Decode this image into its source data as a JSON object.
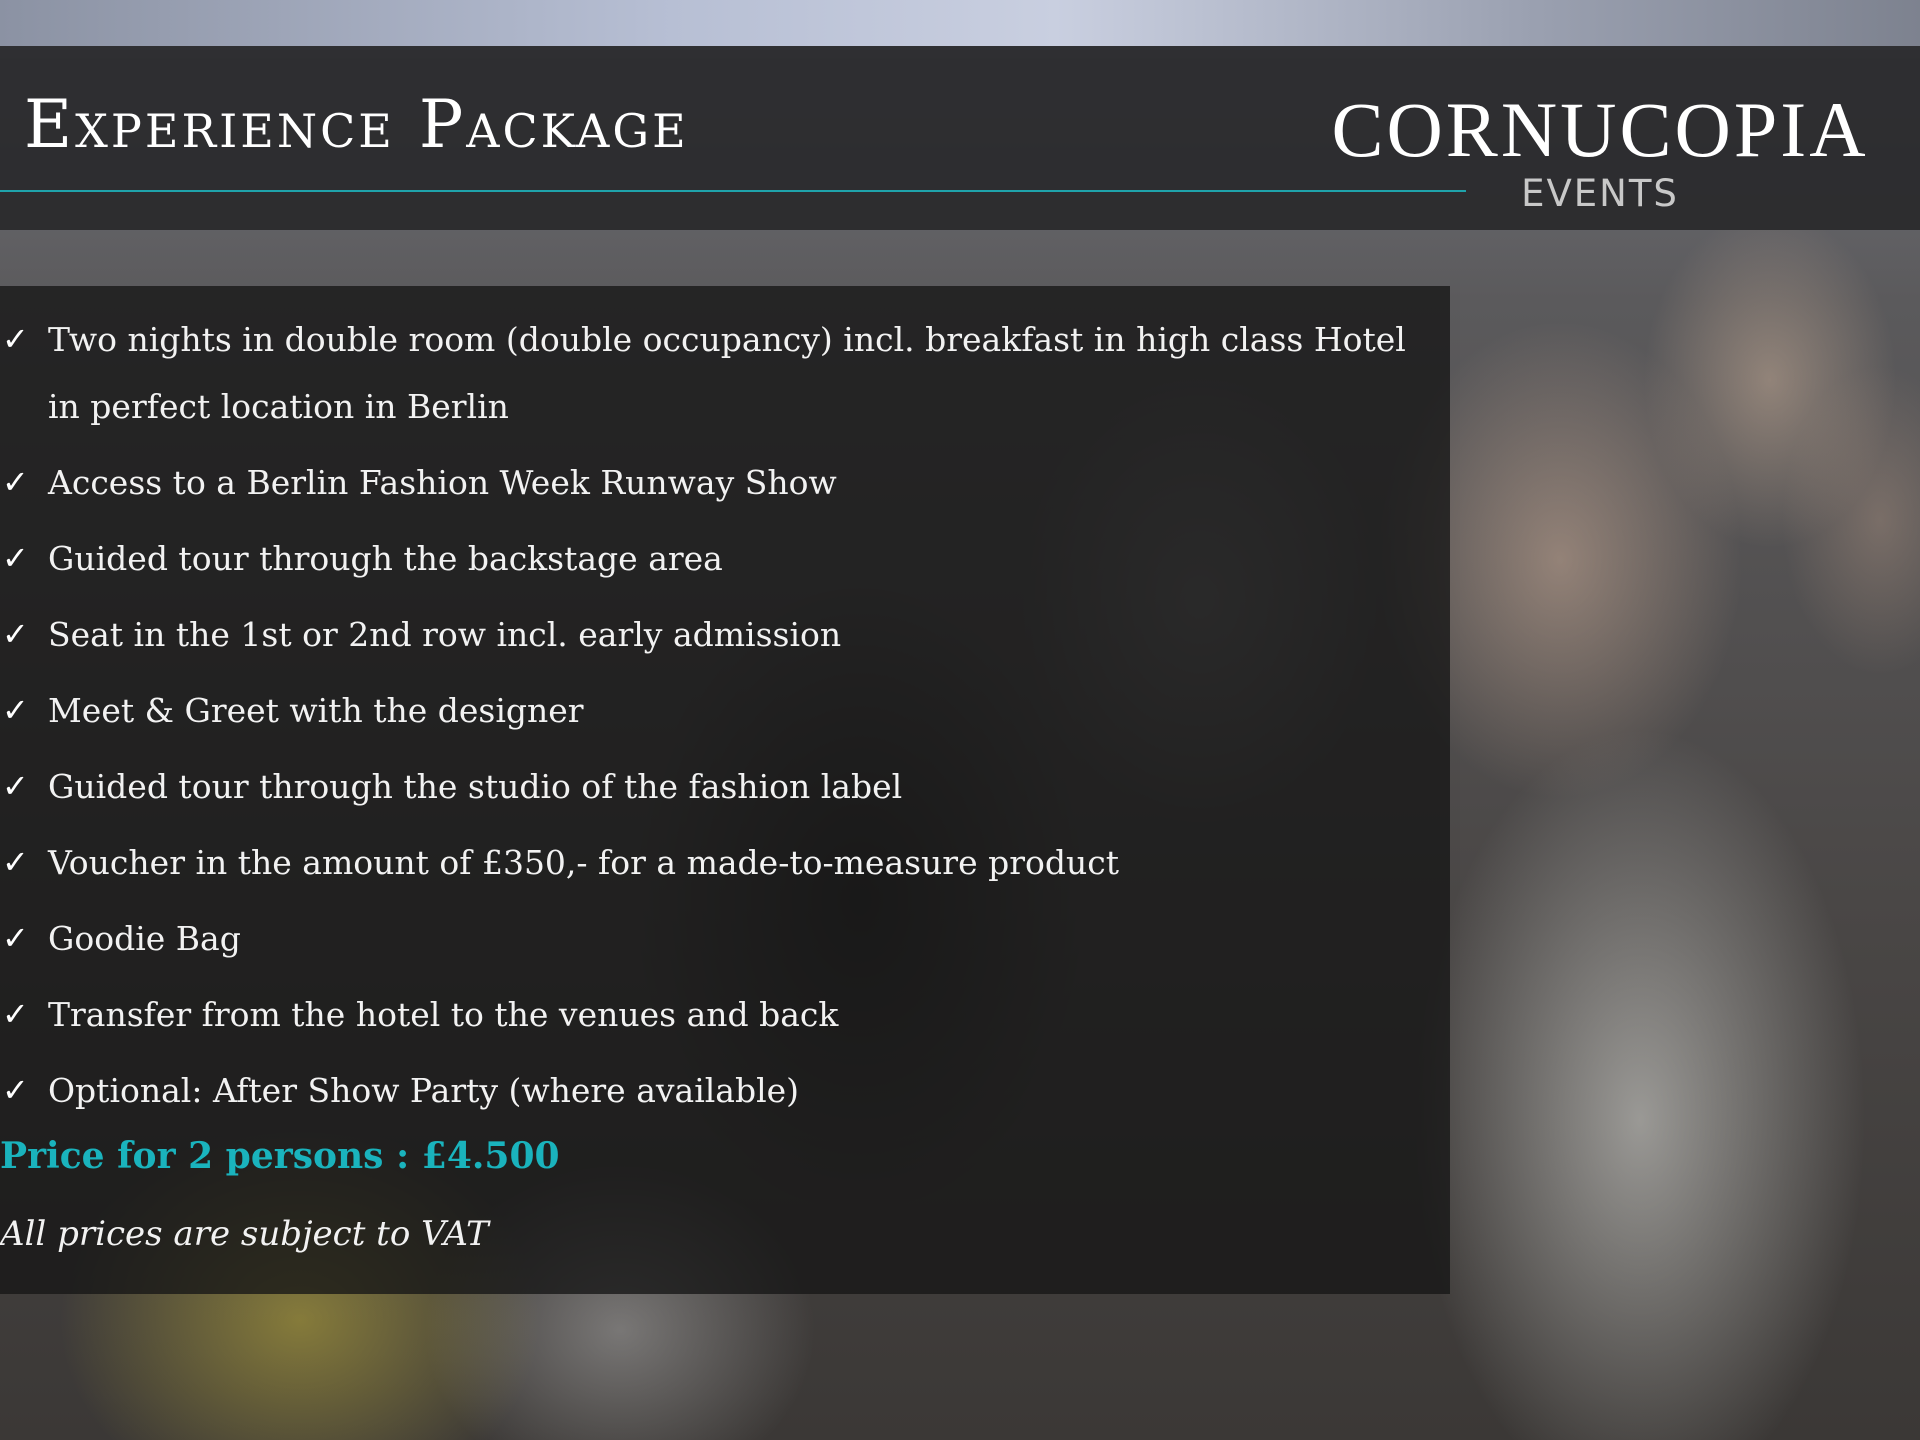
{
  "header": {
    "title": "Experience Package"
  },
  "logo": {
    "name": "CORNUCOPIA",
    "sub": "EVENTS"
  },
  "features": {
    "icon": "check-icon",
    "glyph": "✓",
    "items": [
      "Two nights in double room (double occupancy) incl. breakfast in high class Hotel in perfect location in Berlin",
      "Access to a Berlin Fashion Week Runway Show",
      "Guided tour through the backstage area",
      "Seat in the 1st or 2nd row incl. early admission",
      "Meet & Greet with the designer",
      "Guided tour through the studio of the fashion label",
      "Voucher in the amount of  £350,- for a made-to-measure product",
      "Goodie Bag",
      "Transfer from the hotel to the venues and back",
      "Optional: After Show Party (where available)"
    ]
  },
  "pricing": {
    "price_text": "Price for 2 persons : £4.500",
    "vat_note": "All prices are subject to VAT"
  },
  "colors": {
    "accent": "#1ab3bd",
    "rule": "#1fa3ab",
    "header_band": "#262628",
    "text": "#f2f2f2"
  }
}
